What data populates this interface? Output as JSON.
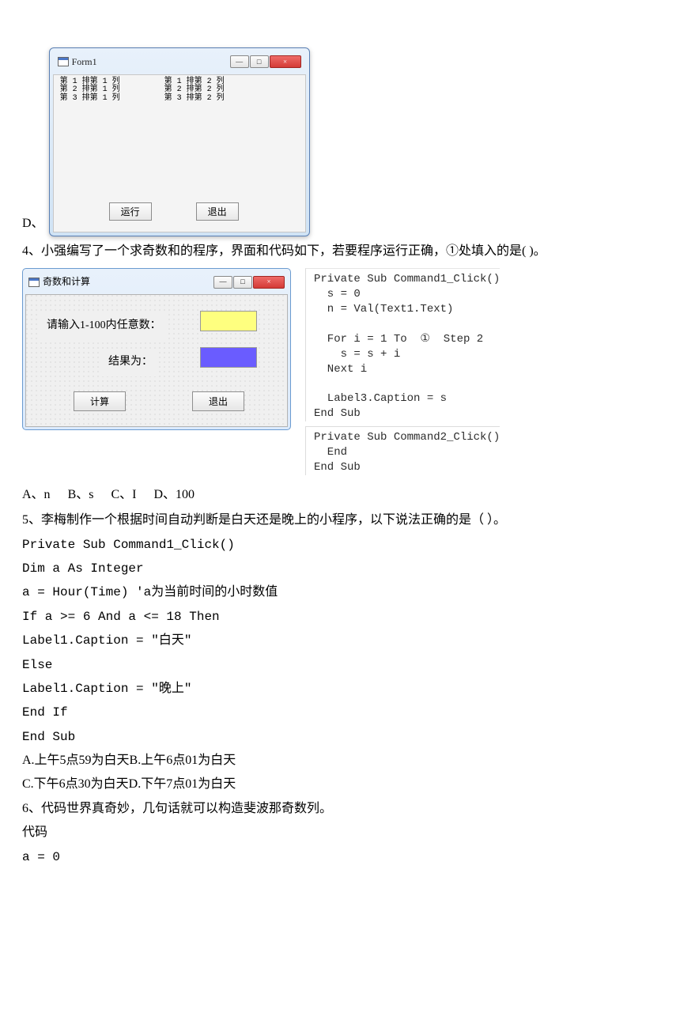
{
  "form1": {
    "title": "Form1",
    "col1": "第 1 排第 1 列\n第 2 排第 1 列\n第 3 排第 1 列",
    "col2": "第 1 排第 2 列\n第 2 排第 2 列\n第 3 排第 2 列",
    "run_btn": "运行",
    "exit_btn": "退出",
    "option_d": "D、"
  },
  "q4": {
    "stem": "4、小强编写了一个求奇数和的程序，界面和代码如下，若要程序运行正确，①处填入的是(  )。",
    "win_title": "奇数和计算",
    "label_input": "请输入1-100内任意数：",
    "label_result": "结果为：",
    "btn_calc": "计算",
    "btn_exit": "退出",
    "code1": "Private Sub Command1_Click()\n  s = 0\n  n = Val(Text1.Text)\n\n  For i = 1 To  ①  Step 2\n    s = s + i\n  Next i\n\n  Label3.Caption = s\nEnd Sub",
    "code2": "Private Sub Command2_Click()\n  End\nEnd Sub",
    "opt_a": "A、n",
    "opt_b": "B、s",
    "opt_c": "C、I",
    "opt_d": "D、100"
  },
  "q5": {
    "stem": "5、李梅制作一个根据时间自动判断是白天还是晚上的小程序，以下说法正确的是（    ）。",
    "l1": "Private Sub Command1_Click()",
    "l2": "Dim a As Integer",
    "l3": "a = Hour(Time) 'a为当前时间的小时数值",
    "l4": "If a >= 6 And a <= 18 Then",
    "l5": "Label1.Caption = \"白天\"",
    "l6": "Else",
    "l7": "Label1.Caption = \"晚上\"",
    "l8": "End If",
    "l9": "End Sub",
    "opts1": "A.上午5点59为白天B.上午6点01为白天",
    "opts2": "C.下午6点30为白天D.下午7点01为白天"
  },
  "q6": {
    "stem": "6、代码世界真奇妙，几句话就可以构造斐波那奇数列。",
    "l1": "代码",
    "l2": "a = 0"
  },
  "winctrl": {
    "min": "—",
    "max": "□",
    "close": "×"
  }
}
